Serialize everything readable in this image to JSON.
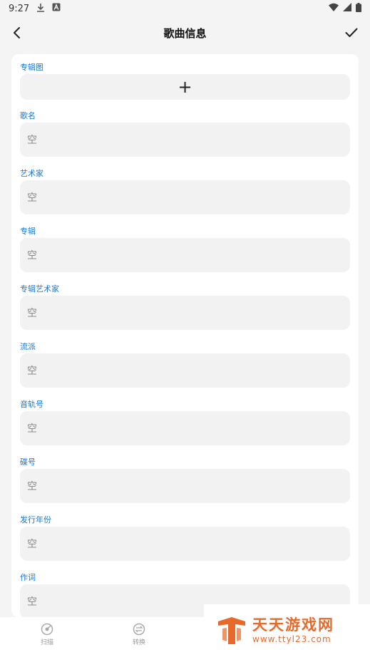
{
  "status": {
    "time": "9:27"
  },
  "app_bar": {
    "title": "歌曲信息"
  },
  "album_art": {
    "label": "专辑图",
    "add_glyph": "+"
  },
  "fields": [
    {
      "label": "歌名",
      "placeholder": "空"
    },
    {
      "label": "艺术家",
      "placeholder": "空"
    },
    {
      "label": "专辑",
      "placeholder": "空"
    },
    {
      "label": "专辑艺术家",
      "placeholder": "空"
    },
    {
      "label": "流派",
      "placeholder": "空"
    },
    {
      "label": "音轨号",
      "placeholder": "空"
    },
    {
      "label": "碟号",
      "placeholder": "空"
    },
    {
      "label": "发行年份",
      "placeholder": "空"
    },
    {
      "label": "作词",
      "placeholder": "空"
    }
  ],
  "bottom_nav": [
    {
      "label": "扫描",
      "icon": "scan-icon"
    },
    {
      "label": "转换",
      "icon": "convert-icon"
    }
  ],
  "watermark": {
    "title": "天天游戏网",
    "url": "www.ttyl23.com"
  },
  "colors": {
    "accent": "#1976d2",
    "field_bg": "#f2f2f2",
    "watermark": "#e86a2a"
  }
}
